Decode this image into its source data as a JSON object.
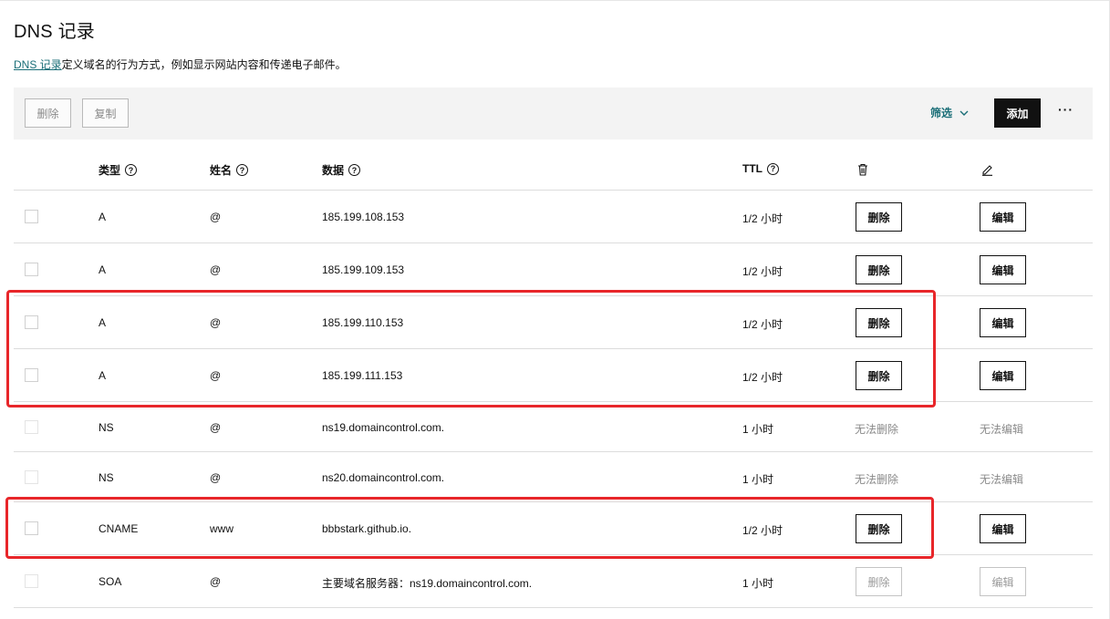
{
  "header": {
    "title": "DNS 记录",
    "desc_link": "DNS 记录",
    "desc_text": "定义域名的行为方式，例如显示网站内容和传递电子邮件。"
  },
  "toolbar": {
    "delete_label": "删除",
    "copy_label": "复制",
    "filter_label": "筛选",
    "add_label": "添加",
    "more_label": "···"
  },
  "table": {
    "headers": {
      "type": "类型",
      "name": "姓名",
      "data": "数据",
      "ttl": "TTL"
    },
    "rows": [
      {
        "type": "A",
        "name": "@",
        "data": "185.199.108.153",
        "ttl": "1/2 小时",
        "delete": "删除",
        "edit": "编辑",
        "state": "enabled"
      },
      {
        "type": "A",
        "name": "@",
        "data": "185.199.109.153",
        "ttl": "1/2 小时",
        "delete": "删除",
        "edit": "编辑",
        "state": "enabled"
      },
      {
        "type": "A",
        "name": "@",
        "data": "185.199.110.153",
        "ttl": "1/2 小时",
        "delete": "删除",
        "edit": "编辑",
        "state": "enabled"
      },
      {
        "type": "A",
        "name": "@",
        "data": "185.199.111.153",
        "ttl": "1/2 小时",
        "delete": "删除",
        "edit": "编辑",
        "state": "enabled"
      },
      {
        "type": "NS",
        "name": "@",
        "data": "ns19.domaincontrol.com.",
        "ttl": "1 小时",
        "delete": "无法删除",
        "edit": "无法编辑",
        "state": "locked"
      },
      {
        "type": "NS",
        "name": "@",
        "data": "ns20.domaincontrol.com.",
        "ttl": "1 小时",
        "delete": "无法删除",
        "edit": "无法编辑",
        "state": "locked"
      },
      {
        "type": "CNAME",
        "name": "www",
        "data": "bbbstark.github.io.",
        "ttl": "1/2 小时",
        "delete": "删除",
        "edit": "编辑",
        "state": "enabled"
      },
      {
        "type": "SOA",
        "name": "@",
        "data": "主要域名服务器：ns19.domaincontrol.com.",
        "ttl": "1 小时",
        "delete": "删除",
        "edit": "编辑",
        "state": "disabled"
      }
    ]
  },
  "colors": {
    "link": "#1a6e77",
    "highlight": "#e8262a",
    "primary_button": "#111111"
  }
}
